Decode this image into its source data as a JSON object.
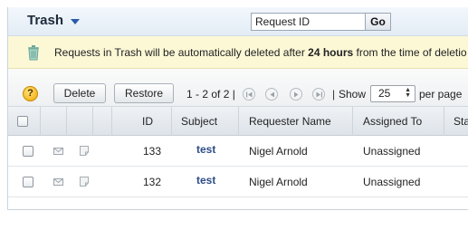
{
  "header": {
    "title": "Trash",
    "search_value": "Request ID",
    "go_label": "Go"
  },
  "notice": {
    "text_before": "Requests in Trash will be automatically deleted after ",
    "bold": "24 hours",
    "text_after": " from the time of deletio"
  },
  "toolbar": {
    "help_glyph": "?",
    "delete_label": "Delete",
    "restore_label": "Restore",
    "pager_text": "1 - 2 of 2 |",
    "separator": "|",
    "show_label": "Show",
    "per_page_value": "25",
    "per_page_label": "per page"
  },
  "table": {
    "columns": {
      "id": "ID",
      "subject": "Subject",
      "requester": "Requester Name",
      "assigned": "Assigned To",
      "status": "Sta"
    },
    "rows": [
      {
        "id": "133",
        "subject": "test",
        "requester": "Nigel Arnold",
        "assigned": "Unassigned"
      },
      {
        "id": "132",
        "subject": "test",
        "requester": "Nigel Arnold",
        "assigned": "Unassigned"
      }
    ]
  },
  "colors": {
    "accent": "#2a5aa8",
    "link": "#2c4c87",
    "notice_bg": "#fcf8d6",
    "header_bg": "#e3ecf5"
  },
  "icons": [
    "chevron-down-icon",
    "trash-can-icon",
    "help-icon",
    "first-page-icon",
    "prev-page-icon",
    "next-page-icon",
    "last-page-icon",
    "mail-icon",
    "note-icon"
  ]
}
